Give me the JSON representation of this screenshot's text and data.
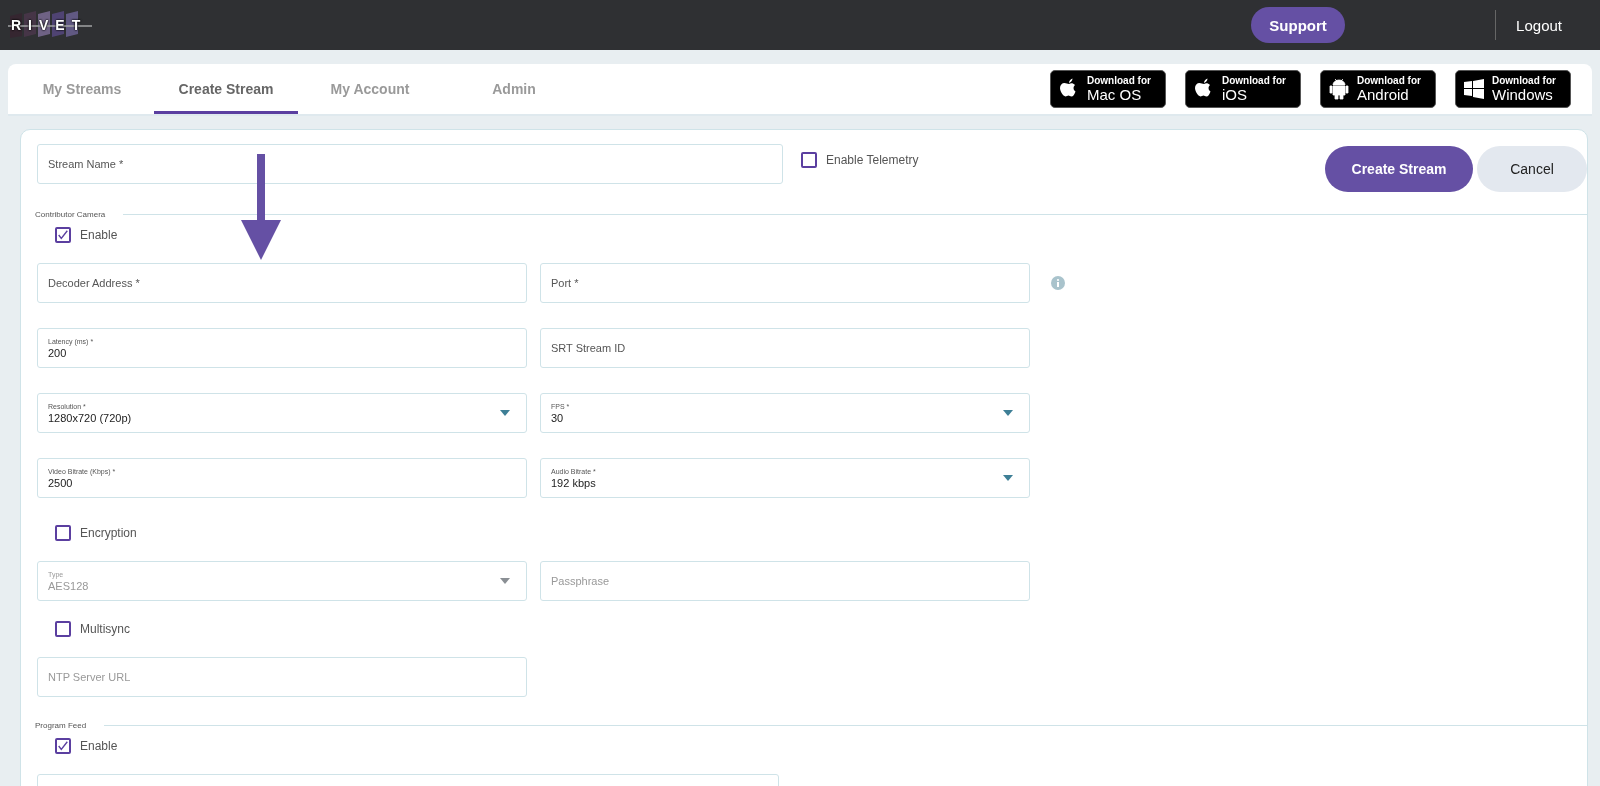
{
  "header": {
    "logo": "RIVET",
    "support_button": "Support",
    "logout": "Logout"
  },
  "tabs": [
    {
      "label": "My Streams",
      "selected": false
    },
    {
      "label": "Create Stream",
      "selected": true
    },
    {
      "label": "My Account",
      "selected": false
    },
    {
      "label": "Admin",
      "selected": false
    }
  ],
  "downloads": [
    {
      "kind": "apple",
      "caption": "Download for",
      "platform": "Mac OS"
    },
    {
      "kind": "apple",
      "caption": "Download for",
      "platform": "iOS"
    },
    {
      "kind": "android",
      "caption": "Download for",
      "platform": "Android"
    },
    {
      "kind": "windows",
      "caption": "Download for",
      "platform": "Windows"
    }
  ],
  "form": {
    "stream_name": {
      "placeholder": "Stream Name *"
    },
    "telemetry": {
      "label": "Enable Telemetry",
      "checked": false
    },
    "create_button": "Create Stream",
    "cancel_button": "Cancel"
  },
  "sections": [
    {
      "title": "Contributor Camera",
      "enable": {
        "label": "Enable",
        "checked": true
      },
      "rows": [
        {
          "kind": "fields",
          "fields": [
            {
              "kind": "text",
              "placeholder": "Decoder Address *",
              "disabled": false
            },
            {
              "kind": "text",
              "placeholder": "Port *",
              "disabled": false
            }
          ],
          "info": true
        },
        {
          "kind": "fields",
          "fields": [
            {
              "kind": "text",
              "label": "Latency (ms) *",
              "value": "200",
              "disabled": false
            },
            {
              "kind": "text",
              "placeholder": "SRT Stream ID",
              "disabled": false
            }
          ],
          "info": false
        },
        {
          "kind": "fields",
          "fields": [
            {
              "kind": "select",
              "label": "Resolution *",
              "value": "1280x720 (720p)",
              "disabled": false
            },
            {
              "kind": "select",
              "label": "FPS *",
              "value": "30",
              "disabled": false
            }
          ],
          "info": false
        },
        {
          "kind": "fields",
          "fields": [
            {
              "kind": "text",
              "label": "Video Bitrate (Kbps) *",
              "value": "2500",
              "disabled": false
            },
            {
              "kind": "select",
              "label": "Audio Bitrate *",
              "value": "192 kbps",
              "disabled": false
            }
          ],
          "info": false
        },
        {
          "kind": "checkbox",
          "label": "Encryption",
          "checked": false
        },
        {
          "kind": "fields",
          "fields": [
            {
              "kind": "select",
              "label": "Type",
              "value": "AES128",
              "disabled": true
            },
            {
              "kind": "text",
              "placeholder": "Passphrase",
              "disabled": true
            }
          ],
          "info": false
        },
        {
          "kind": "checkbox",
          "label": "Multisync",
          "checked": false
        },
        {
          "kind": "fields",
          "fields": [
            {
              "kind": "text",
              "placeholder": "NTP Server URL",
              "disabled": true
            }
          ],
          "info": false
        }
      ]
    },
    {
      "title": "Program Feed",
      "enable": {
        "label": "Enable",
        "checked": true
      },
      "rows": [
        {
          "kind": "fields",
          "fields": [
            {
              "kind": "wide"
            }
          ]
        }
      ]
    }
  ]
}
